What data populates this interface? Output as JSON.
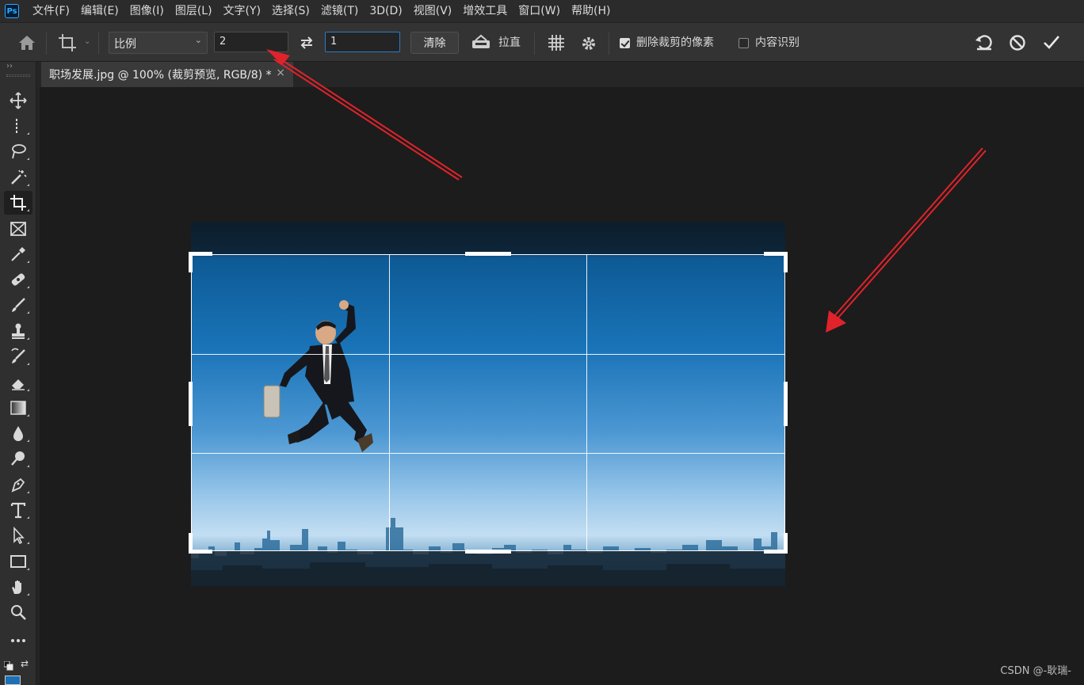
{
  "app": {
    "logo_text": "Ps"
  },
  "menu": [
    "文件(F)",
    "编辑(E)",
    "图像(I)",
    "图层(L)",
    "文字(Y)",
    "选择(S)",
    "滤镜(T)",
    "3D(D)",
    "视图(V)",
    "增效工具",
    "窗口(W)",
    "帮助(H)"
  ],
  "options": {
    "ratio_preset": "比例",
    "width_value": "2",
    "height_value": "1",
    "clear_label": "清除",
    "straighten_label": "拉直",
    "delete_cropped_label": "删除裁剪的像素",
    "delete_cropped_checked": true,
    "content_aware_label": "内容识别",
    "content_aware_checked": false
  },
  "document": {
    "tab_title": "职场发展.jpg @ 100% (裁剪预览, RGB/8) *",
    "close_glyph": "×"
  },
  "tools": [
    "move-tool",
    "marquee-tool",
    "lasso-tool",
    "magic-wand-tool",
    "crop-tool",
    "frame-tool",
    "eyedropper-tool",
    "healing-brush-tool",
    "brush-tool",
    "clone-stamp-tool",
    "history-brush-tool",
    "eraser-tool",
    "gradient-tool",
    "blur-tool",
    "dodge-tool",
    "pen-tool",
    "type-tool",
    "path-selection-tool",
    "rectangle-tool",
    "hand-tool",
    "zoom-tool",
    "more-tools"
  ],
  "tools_active": "crop-tool",
  "colors": {
    "annotation_arrow": "#e0232b",
    "foreground_swatch": "#1e6fb4"
  },
  "watermark": "CSDN @-耿瑞-"
}
